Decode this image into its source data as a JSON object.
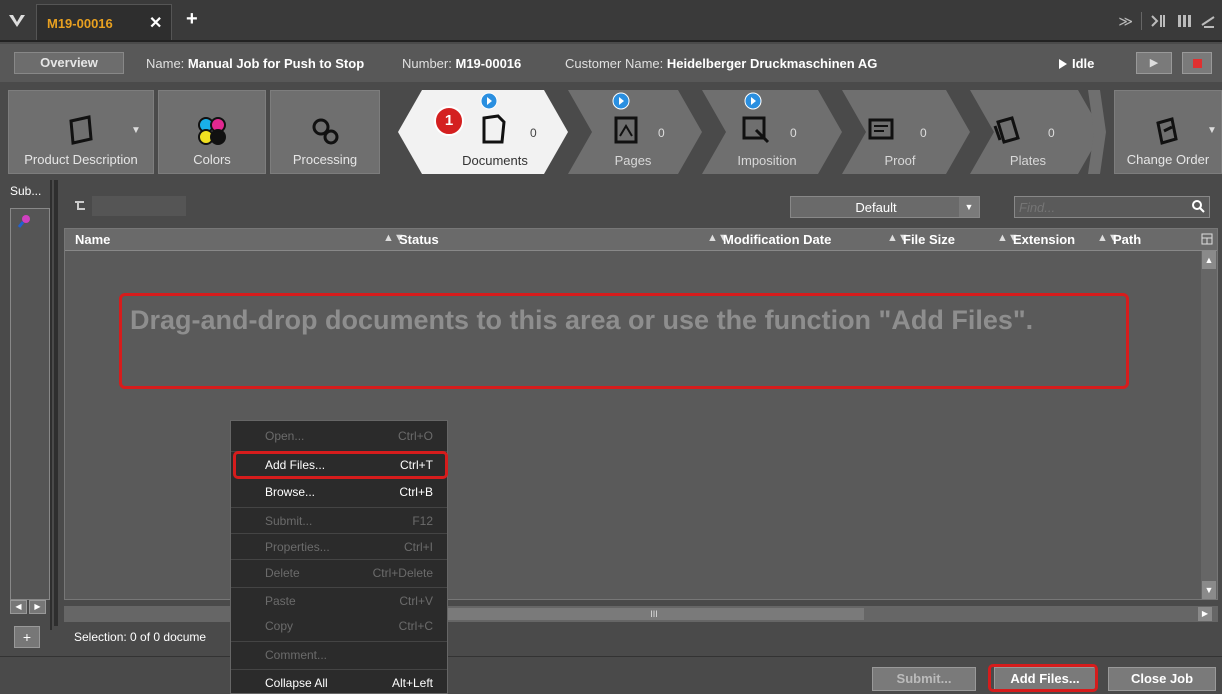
{
  "tabbar": {
    "tab_label": "M19-00016",
    "close_glyph": "✕",
    "add_glyph": "+",
    "menu_glyph": "≫"
  },
  "infobar": {
    "overview_label": "Overview",
    "name_label": "Name:",
    "name_value": "Manual Job for Push to Stop",
    "number_label": "Number:",
    "number_value": "M19-00016",
    "customer_label": "Customer Name:",
    "customer_value": "Heidelberger Druckmaschinen AG",
    "status": "Idle"
  },
  "workflow": {
    "product_description": "Product Description",
    "colors": "Colors",
    "processing": "Processing",
    "documents": "Documents",
    "documents_count": "0",
    "pages": "Pages",
    "pages_count": "0",
    "imposition": "Imposition",
    "imposition_count": "0",
    "proof": "Proof",
    "proof_count": "0",
    "plates": "Plates",
    "plates_count": "0",
    "change_order": "Change Order",
    "badge": "1"
  },
  "sidepanel": {
    "label": "Sub...",
    "nav_left": "◀",
    "nav_right": "▶",
    "add": "+"
  },
  "toolbar": {
    "view_value": "Default",
    "find_placeholder": "Find..."
  },
  "grid": {
    "columns": [
      "Name",
      "Status",
      "Modification Date",
      "File Size",
      "Extension",
      "Path"
    ],
    "empty_message": "Drag-and-drop documents to this area or use the function \"Add Files\".",
    "scroll_thumb": "III"
  },
  "statusbar": {
    "selection": "Selection:  0 of 0 docume"
  },
  "footer": {
    "submit": "Submit...",
    "add_files": "Add Files...",
    "close_job": "Close Job"
  },
  "context_menu": [
    {
      "label": "Open...",
      "shortcut": "Ctrl+O",
      "enabled": false
    },
    {
      "label": "Add Files...",
      "shortcut": "Ctrl+T",
      "enabled": true
    },
    {
      "label": "Browse...",
      "shortcut": "Ctrl+B",
      "enabled": true
    },
    {
      "label": "Submit...",
      "shortcut": "F12",
      "enabled": false
    },
    {
      "label": "Properties...",
      "shortcut": "Ctrl+I",
      "enabled": false
    },
    {
      "label": "Delete",
      "shortcut": "Ctrl+Delete",
      "enabled": false
    },
    {
      "label": "Paste",
      "shortcut": "Ctrl+V",
      "enabled": false
    },
    {
      "label": "Copy",
      "shortcut": "Ctrl+C",
      "enabled": false
    },
    {
      "label": "Comment...",
      "shortcut": "",
      "enabled": false
    },
    {
      "label": "Collapse All",
      "shortcut": "Alt+Left",
      "enabled": true
    }
  ],
  "colors": {
    "accent_orange": "#e8a020",
    "highlight_red": "#d61c1c",
    "play_blue": "#2a8fe0"
  }
}
